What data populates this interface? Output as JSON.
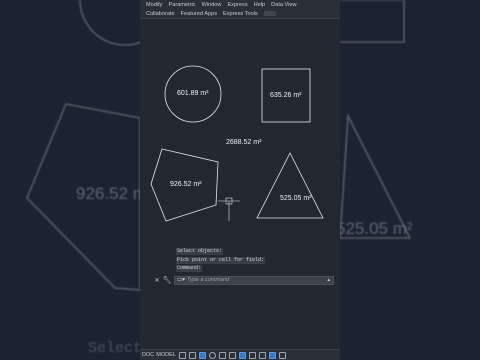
{
  "menu": {
    "items": [
      "Modify",
      "Parametric",
      "Window",
      "Express",
      "Help",
      "Data View"
    ]
  },
  "ribbon": {
    "tabs": [
      "Collaborate",
      "Featured Apps",
      "Express Tools"
    ]
  },
  "drawing": {
    "total_area": "2688.52 m²",
    "circle_area": "601.89 m²",
    "square_area": "635.26 m²",
    "pentagon_area": "926.52 m²",
    "triangle_area": "525.05 m²",
    "stroke_color": "#e6e6e6",
    "canvas_color": "#212830"
  },
  "background": {
    "pentagon_area": "926.52 m",
    "triangle_area": "525.05 m²",
    "select_text": "Select"
  },
  "command": {
    "history": [
      "Select objects:",
      "Pick point or cell for field:",
      "Command:"
    ],
    "placeholder": "Type a command",
    "prompt_icon": "chevron-prompt-icon"
  },
  "statusbar": {
    "model_label": "MODEL",
    "left_label": "DOC"
  }
}
